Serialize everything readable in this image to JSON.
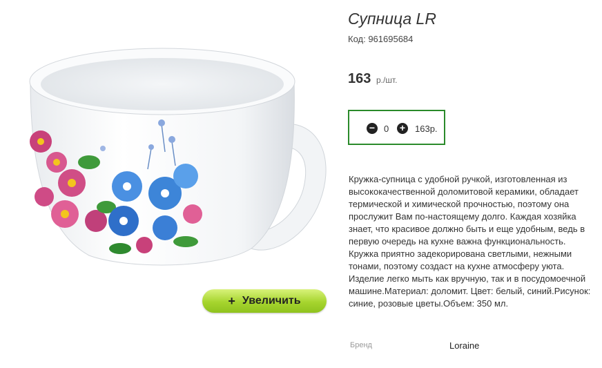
{
  "product": {
    "title": "Супница LR",
    "code": "Код: 961695684",
    "price": "163",
    "price_unit": "р./шт.",
    "image_alt": "Супница LR — белая кружка с цветочным рисунком"
  },
  "quantity": {
    "minus_label": "−",
    "value": "0",
    "plus_label": "+",
    "total": "163р."
  },
  "zoom": {
    "plus": "+",
    "label": "Увеличить"
  },
  "description": "Кружка-супница с удобной ручкой, изготовленная из высококачественной доломитовой керамики, обладает термической и химической прочностью, поэтому она прослужит Вам по-настоящему долго. Каждая хозяйка знает, что красивое должно быть и еще удобным, ведь в первую очередь на кухне важна функциональность. Кружка приятно задекорирована светлыми, нежными тонами, поэтому создаст на кухне атмосферу уюта. Изделие легко мыть как вручную, так и в посудомоечной машине.Материал: доломит. Цвет: белый, синий.Рисунок: синие, розовые цветы.Объем: 350 мл.",
  "specs": {
    "brand_label": "Бренд",
    "brand_value": "Loraine"
  },
  "colors": {
    "accent_green": "#2a8a2a",
    "zoom_button": "#a6d52e"
  }
}
